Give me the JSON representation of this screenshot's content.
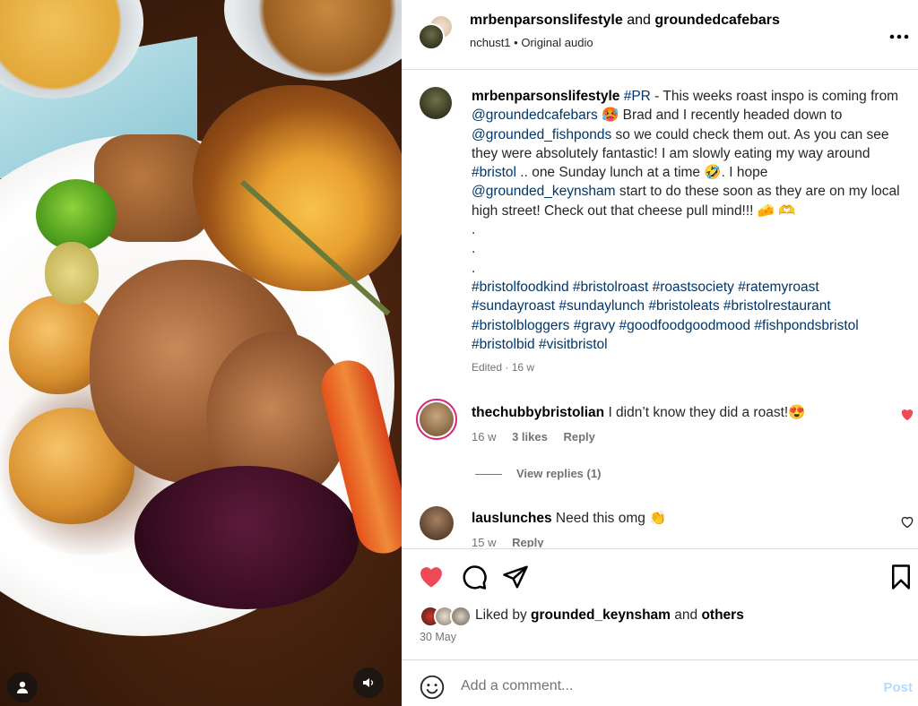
{
  "colors": {
    "accent_link": "#00376b",
    "like_red": "#ed4956",
    "post_disabled": "#b3dbff",
    "divider": "#dbdbdb"
  },
  "header": {
    "author": "mrbenparsonslifestyle",
    "joiner": "and",
    "collaborator": "groundedcafebars",
    "sub_user": "nchust1",
    "separator": "•",
    "audio": "Original audio",
    "more_icon": "more-horizontal-icon"
  },
  "caption": {
    "username": "mrbenparsonslifestyle",
    "t1": "#PR",
    "t2": " - This weeks roast inspo is coming from ",
    "t3": "@groundedcafebars",
    "t4": " 🥵 Brad and I recently headed down to ",
    "t5": "@grounded_fishponds",
    "t6": " so we could check them out. As you can see they were absolutely fantastic! I am slowly eating my way around ",
    "t7": "#bristol",
    "t8": " .. one Sunday lunch at a time 🤣. I hope ",
    "t9": "@grounded_keynsham",
    "t10": " start to do these soon as they are on my local high street! Check out that cheese pull mind!!! 🧀 🫶",
    "dot": ".",
    "hashtags": "#bristolfoodkind #bristolroast #roastsociety #ratemyroast #sundayroast #sundaylunch #bristoleats #bristolrestaurant #bristolbloggers #gravy #goodfoodgoodmood #fishpondsbristol #bristolbid #visitbristol",
    "edited": "Edited · 16 w"
  },
  "comments": [
    {
      "username": "thechubbybristolian",
      "text": "I didn’t know they did a roast!😍",
      "time": "16 w",
      "likes": "3 likes",
      "reply": "Reply",
      "view_replies": "View replies (1)",
      "liked": true
    },
    {
      "username": "lauslunches",
      "text": "Need this omg 👏",
      "time": "15 w",
      "reply": "Reply",
      "liked": false
    }
  ],
  "actions": {
    "like_icon": "heart-filled-icon",
    "comment_icon": "comment-icon",
    "share_icon": "send-icon",
    "save_icon": "bookmark-icon"
  },
  "likes": {
    "prefix": "Liked by",
    "user": "grounded_keynsham",
    "joiner": "and",
    "others": "others"
  },
  "date": "30 May",
  "add_comment": {
    "placeholder": "Add a comment...",
    "post": "Post"
  }
}
